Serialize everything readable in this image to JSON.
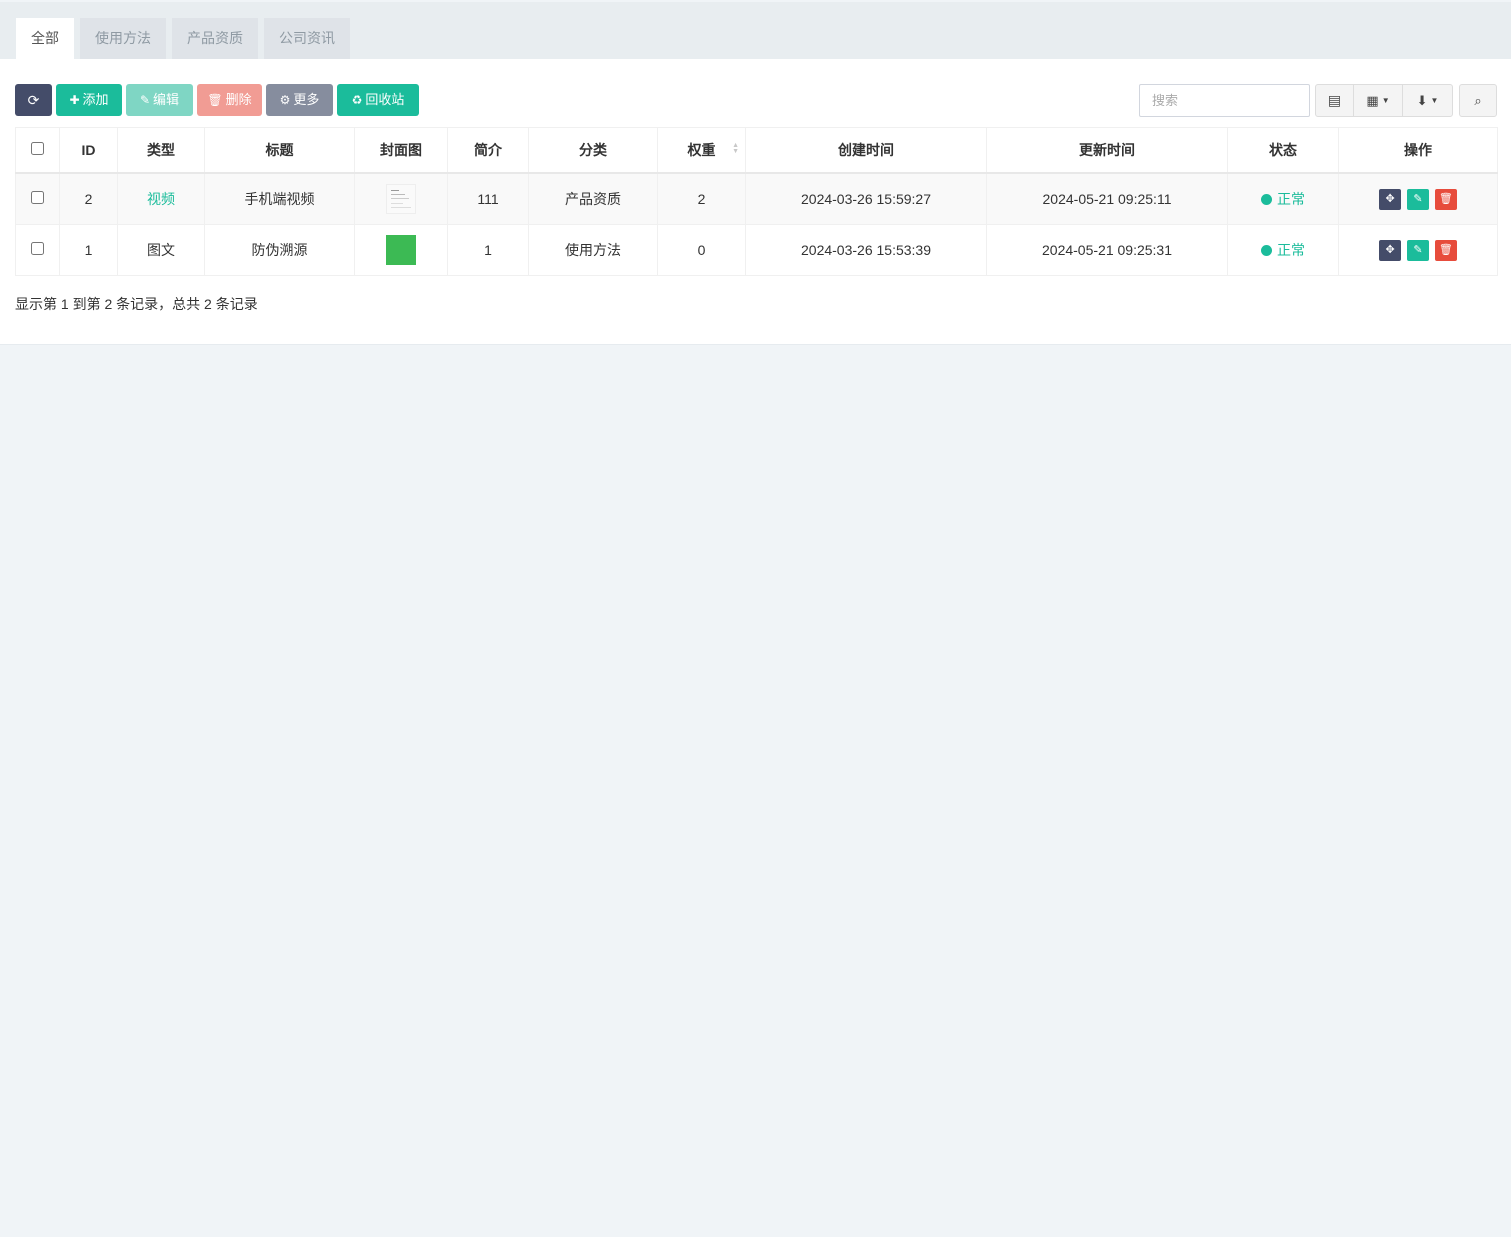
{
  "tabs": [
    {
      "label": "全部",
      "active": true
    },
    {
      "label": "使用方法",
      "active": false
    },
    {
      "label": "产品资质",
      "active": false
    },
    {
      "label": "公司资讯",
      "active": false
    }
  ],
  "toolbar": {
    "refresh_icon": "refresh-icon",
    "add_label": "添加",
    "edit_label": "编辑",
    "delete_label": "删除",
    "more_label": "更多",
    "recycle_label": "回收站",
    "search_placeholder": "搜索"
  },
  "table": {
    "columns": [
      "ID",
      "类型",
      "标题",
      "封面图",
      "简介",
      "分类",
      "权重",
      "创建时间",
      "更新时间",
      "状态",
      "操作"
    ],
    "rows": [
      {
        "id": "2",
        "type": "视频",
        "title": "手机端视频",
        "cover": "document-thumbnail",
        "intro": "111",
        "category": "产品资质",
        "weight": "2",
        "created": "2024-03-26 15:59:27",
        "updated": "2024-05-21 09:25:11",
        "status": "正常"
      },
      {
        "id": "1",
        "type": "图文",
        "title": "防伪溯源",
        "cover": "green-thumbnail",
        "intro": "1",
        "category": "使用方法",
        "weight": "0",
        "created": "2024-03-26 15:53:39",
        "updated": "2024-05-21 09:25:31",
        "status": "正常"
      }
    ]
  },
  "pagination": {
    "summary": "显示第 1 到第 2 条记录，总共 2 条记录"
  },
  "colors": {
    "primary_green": "#1bbc9b",
    "dark": "#444c69",
    "danger": "#e74c3c",
    "background": "#f0f4f7"
  }
}
